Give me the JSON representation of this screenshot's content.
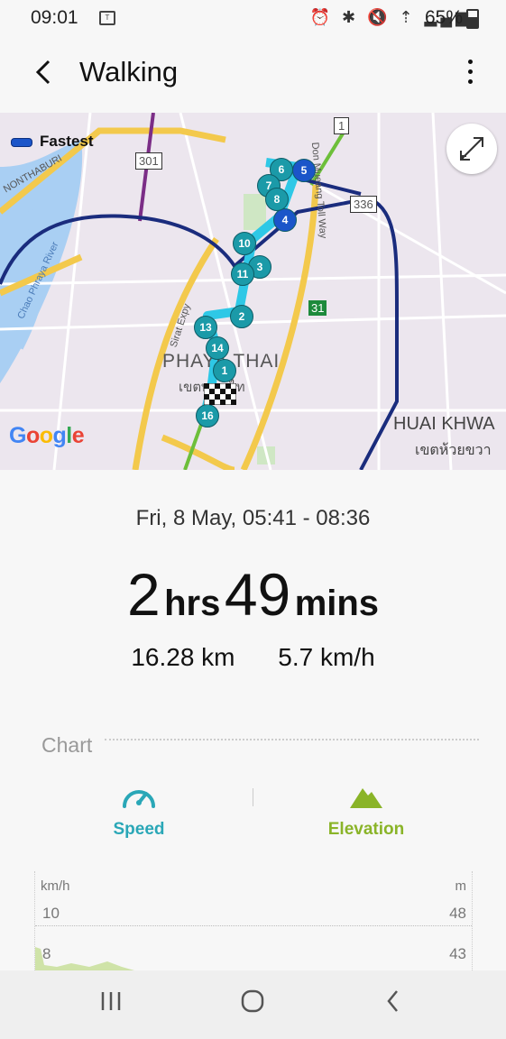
{
  "status_bar": {
    "time": "09:01",
    "battery": "65%"
  },
  "app_bar": {
    "title": "Walking"
  },
  "map": {
    "legend": "Fastest",
    "labels": {
      "district_name": "PHAYA THAI",
      "district_thai": "เขตพญาไท",
      "huai_khwang": "HUAI KHWA",
      "huai_khwang_thai": "เขตห้วยขวา",
      "nonthaburi": "NONTHABURI",
      "chao_phraya": "Chao Phraya River",
      "siam_expy": "Sirat Expy",
      "don_mueang": "Don Mueang Toll Way",
      "route_301": "301",
      "route_336": "336",
      "route_31": "31",
      "route_1": "1"
    },
    "waypoints": [
      "1",
      "2",
      "3",
      "4",
      "5",
      "6",
      "7",
      "8",
      "10",
      "11",
      "13",
      "14",
      "16"
    ],
    "branding": "Google"
  },
  "summary": {
    "date_range": "Fri, 8 May, 05:41 - 08:36",
    "hours": "2",
    "hours_unit": "hrs",
    "minutes": "49",
    "minutes_unit": "mins",
    "distance": "16.28 km",
    "speed": "5.7 km/h"
  },
  "chart": {
    "header": "Chart",
    "tabs": {
      "speed": "Speed",
      "elevation": "Elevation"
    },
    "left_unit": "km/h",
    "right_unit": "m",
    "left_ticks": [
      "10",
      "8"
    ],
    "right_ticks": [
      "48",
      "43"
    ]
  },
  "colors": {
    "speed_accent": "#2aa7b7",
    "elevation_accent": "#8ab428",
    "route_blue": "#1b55c9"
  }
}
